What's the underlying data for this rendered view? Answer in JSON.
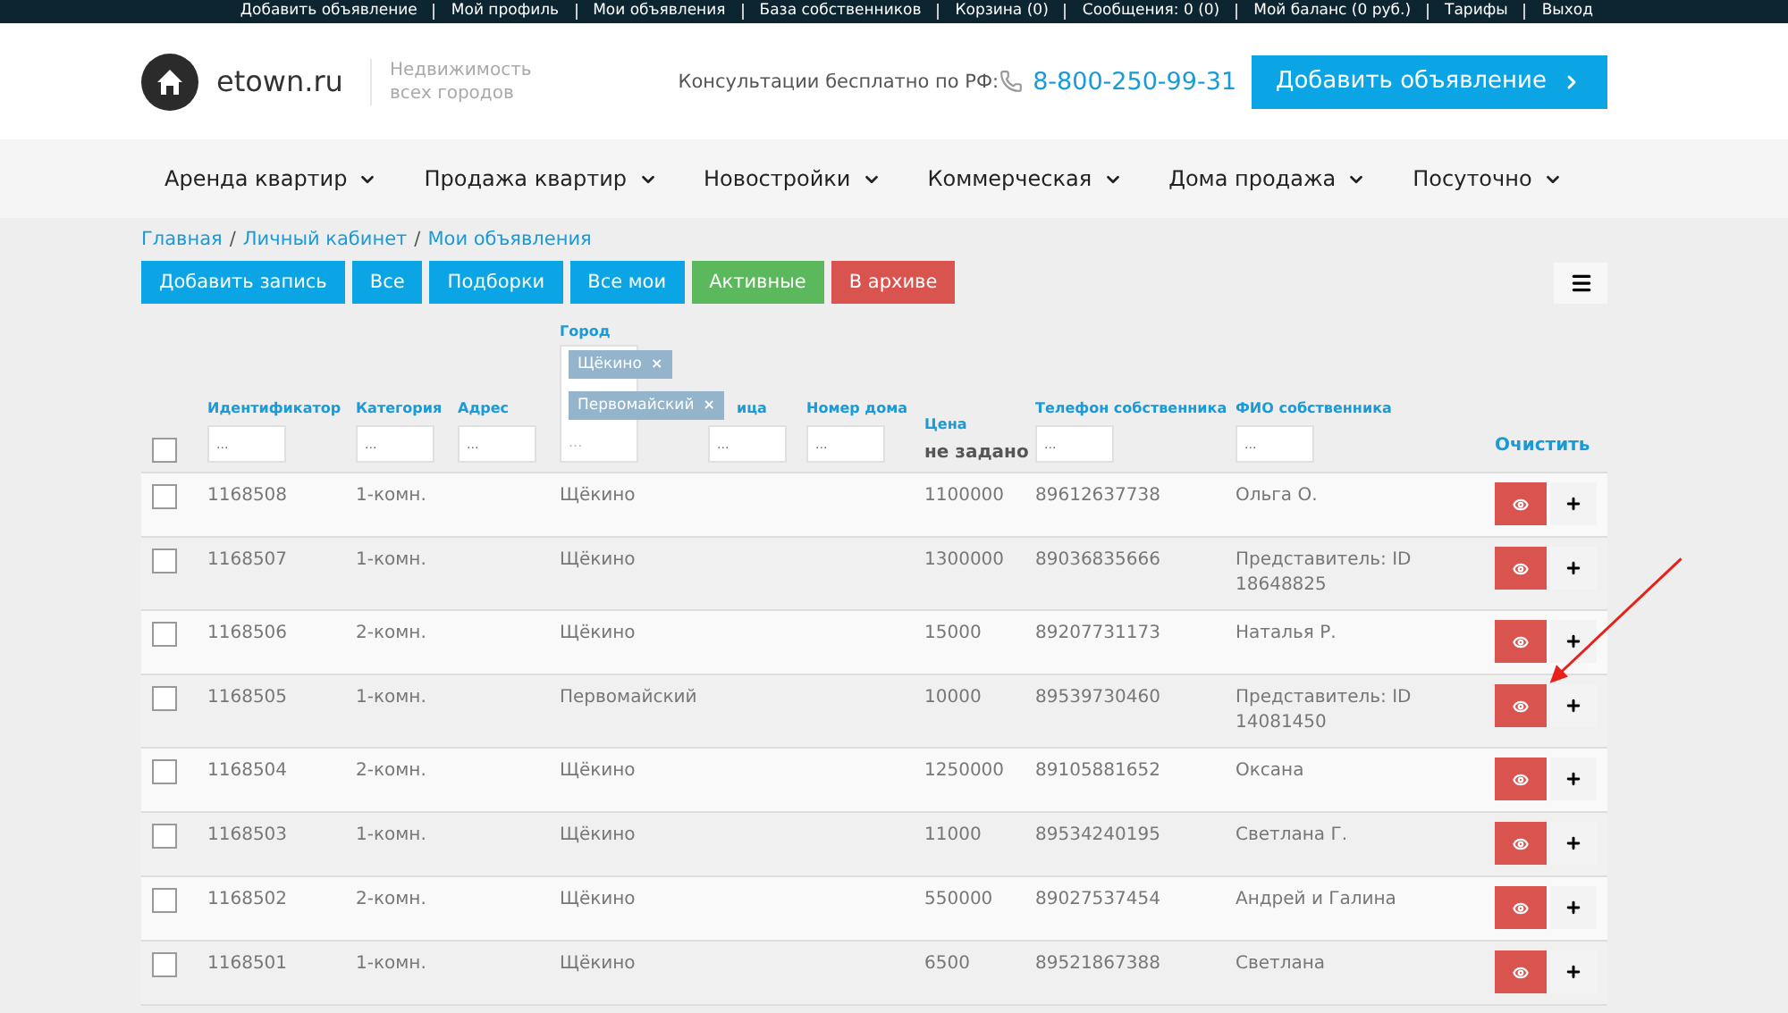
{
  "top_links": [
    "Добавить объявление",
    "Мой профиль",
    "Мои объявления",
    "База собственников",
    "Корзина (0)",
    "Сообщения: 0 (0)",
    "Мой баланс (0 руб.)",
    "Тарифы",
    "Выход"
  ],
  "header": {
    "logo_text": "etown.ru",
    "tagline": "Недвижимость всех городов",
    "consult": "Консультации бесплатно по РФ:",
    "phone": "8-800-250-99-31",
    "cta": "Добавить объявление"
  },
  "nav": [
    "Аренда квартир",
    "Продажа квартир",
    "Новостройки",
    "Коммерческая",
    "Дома продажа",
    "Посуточно"
  ],
  "breadcrumbs": [
    "Главная",
    "Личный кабинет",
    "Мои объявления"
  ],
  "breadcrumb_separator": "/",
  "toolbar": [
    {
      "label": "Добавить запись",
      "color": "#0ba5e6"
    },
    {
      "label": "Все",
      "color": "#0ba5e6"
    },
    {
      "label": "Подборки",
      "color": "#0ba5e6"
    },
    {
      "label": "Все мои",
      "color": "#0ba5e6"
    },
    {
      "label": "Активные",
      "color": "#5cb85c"
    },
    {
      "label": "В архиве",
      "color": "#d9534f"
    }
  ],
  "filters": {
    "select_all_checked": false,
    "columns": [
      {
        "kind": "text",
        "label": "Идентификатор",
        "placeholder": "..."
      },
      {
        "kind": "text",
        "label": "Категория",
        "placeholder": "..."
      },
      {
        "kind": "text",
        "label": "Адрес",
        "placeholder": "..."
      },
      {
        "kind": "tags",
        "label": "Город",
        "placeholder": "...",
        "tags": [
          "Щёкино",
          "Первомайский"
        ],
        "remove_mark": "×"
      },
      {
        "kind": "text",
        "label": "ица",
        "placeholder": "..."
      },
      {
        "kind": "text",
        "label": "Номер дома",
        "placeholder": "..."
      },
      {
        "kind": "value",
        "label": "Цена",
        "value": "не задано"
      },
      {
        "kind": "text",
        "label": "Телефон собственника",
        "placeholder": "..."
      },
      {
        "kind": "text",
        "label": "ФИО собственника",
        "placeholder": "..."
      },
      {
        "kind": "clear",
        "label": "Очистить"
      }
    ]
  },
  "rows": [
    {
      "checked": false,
      "id": "1168508",
      "category": "1-комн.",
      "city": "Щёкино",
      "price": "1100000",
      "phone": "89612637738",
      "owner": "Ольга О."
    },
    {
      "checked": false,
      "id": "1168507",
      "category": "1-комн.",
      "city": "Щёкино",
      "price": "1300000",
      "phone": "89036835666",
      "owner": "Представитель: ID 18648825"
    },
    {
      "checked": false,
      "id": "1168506",
      "category": "2-комн.",
      "city": "Щёкино",
      "price": "15000",
      "phone": "89207731173",
      "owner": "Наталья Р."
    },
    {
      "checked": false,
      "id": "1168505",
      "category": "1-комн.",
      "city": "Первомайский",
      "price": "10000",
      "phone": "89539730460",
      "owner": "Представитель: ID 14081450"
    },
    {
      "checked": false,
      "id": "1168504",
      "category": "2-комн.",
      "city": "Щёкино",
      "price": "1250000",
      "phone": "89105881652",
      "owner": "Оксана"
    },
    {
      "checked": false,
      "id": "1168503",
      "category": "1-комн.",
      "city": "Щёкино",
      "price": "11000",
      "phone": "89534240195",
      "owner": "Светлана Г."
    },
    {
      "checked": false,
      "id": "1168502",
      "category": "2-комн.",
      "city": "Щёкино",
      "price": "550000",
      "phone": "89027537454",
      "owner": "Андрей и Галина"
    },
    {
      "checked": false,
      "id": "1168501",
      "category": "1-комн.",
      "city": "Щёкино",
      "price": "6500",
      "phone": "89521867388",
      "owner": "Светлана"
    }
  ]
}
